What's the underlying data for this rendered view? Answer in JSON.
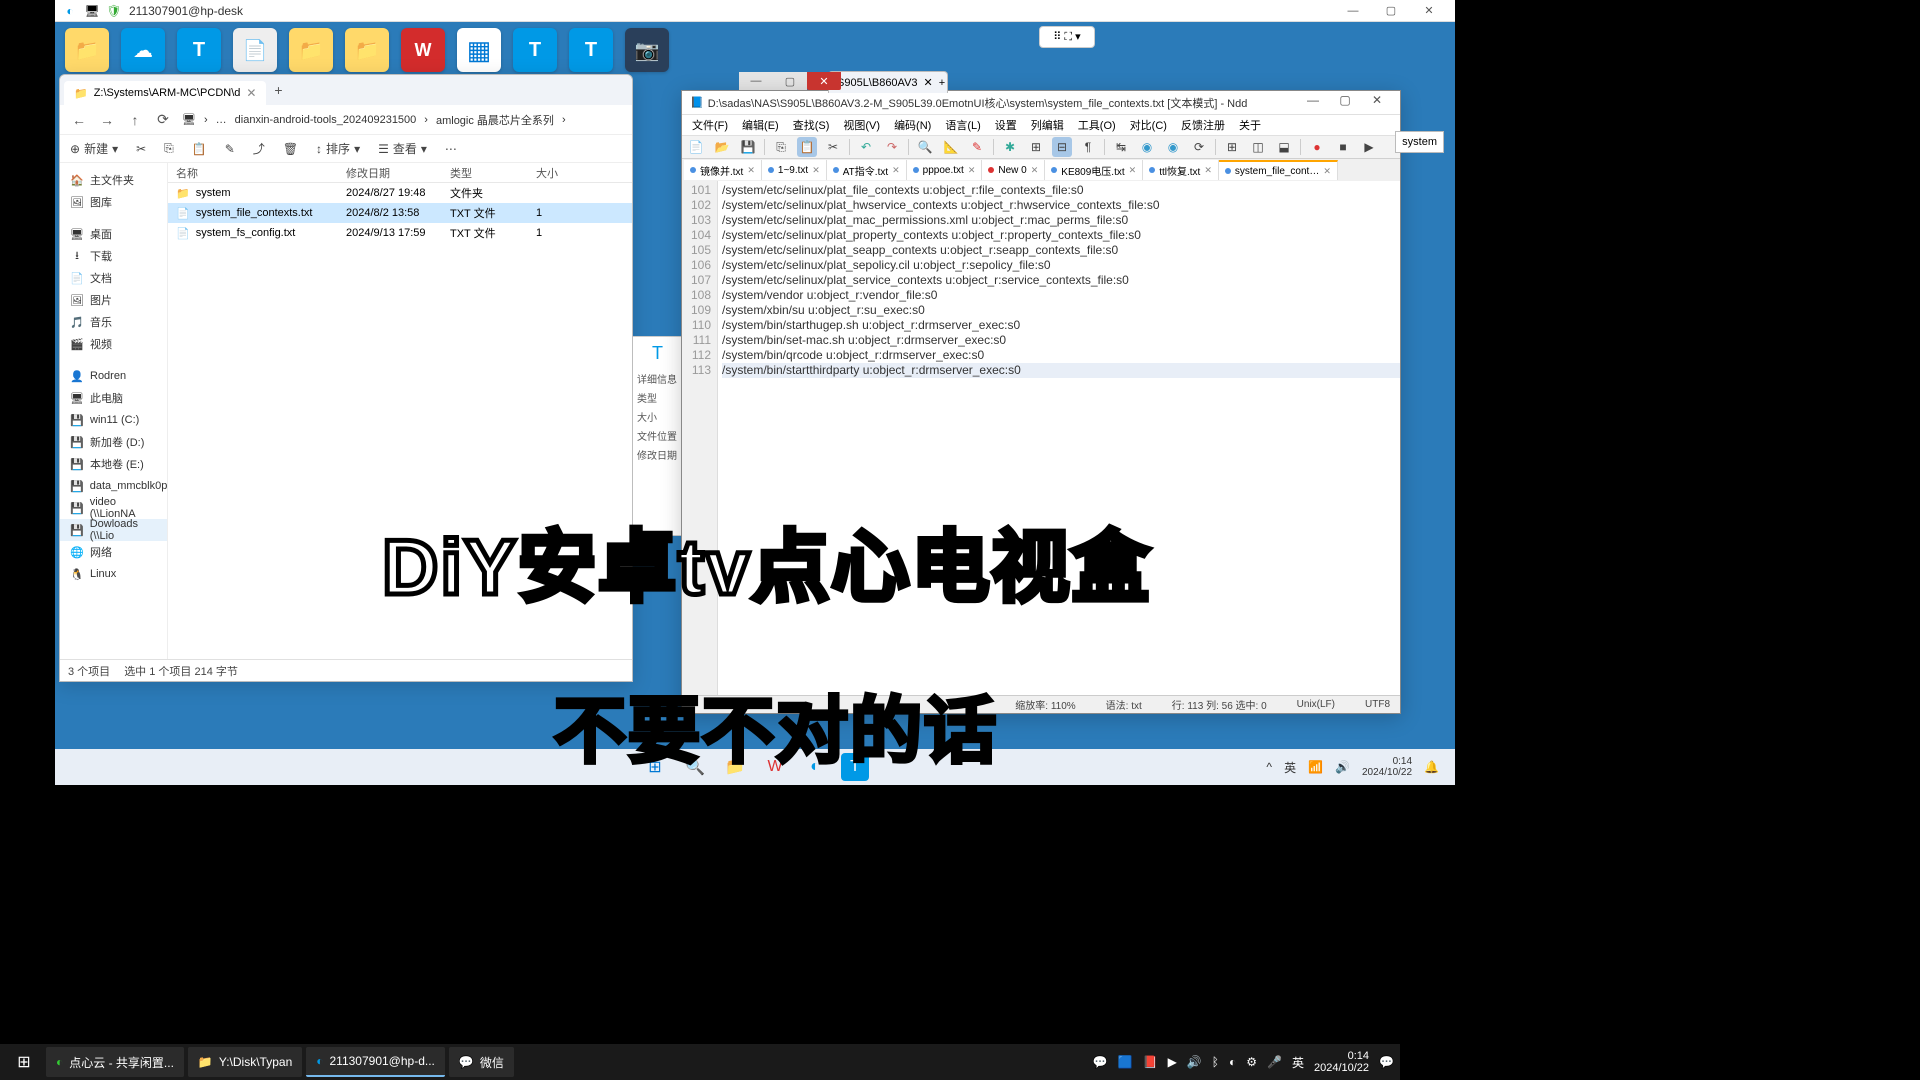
{
  "remote": {
    "title": "211307901@hp-desk"
  },
  "pill": "⠿ ⛶ ▾",
  "explorer": {
    "tab": "Z:\\Systems\\ARM-MC\\PCDN\\d",
    "bc1": "dianxin-android-tools_202409231500",
    "bc2": "amlogic 晶晨芯片全系列",
    "new": "新建",
    "sort": "排序",
    "view": "查看",
    "hdr": {
      "name": "名称",
      "date": "修改日期",
      "type": "类型",
      "size": "大小"
    },
    "files": [
      {
        "name": "system",
        "date": "2024/8/27 19:48",
        "type": "文件夹",
        "size": ""
      },
      {
        "name": "system_file_contexts.txt",
        "date": "2024/8/2 13:58",
        "type": "TXT 文件",
        "size": "1"
      },
      {
        "name": "system_fs_config.txt",
        "date": "2024/9/13 17:59",
        "type": "TXT 文件",
        "size": "1"
      }
    ],
    "side": {
      "home": "主文件夹",
      "gallery": "图库",
      "desktop": "桌面",
      "downloads": "下载",
      "documents": "文档",
      "pictures": "图片",
      "music": "音乐",
      "videos": "视频",
      "rodren": "Rodren",
      "pc": "此电脑",
      "drives": [
        "win11 (C:)",
        "新加卷 (D:)",
        "本地卷 (E:)",
        "data_mmcblk0p",
        "video (\\\\LionNA",
        "Dowloads (\\\\Lio"
      ],
      "network": "网络",
      "linux": "Linux"
    },
    "status": {
      "items": "3 个项目",
      "sel": "选中 1 个项目  214 字节"
    }
  },
  "bcard": {
    "title": "详细信息",
    "rows": [
      "类型",
      "大小",
      "文件位置",
      "修改日期"
    ]
  },
  "editor": {
    "extra_tab": "S905L\\B860AV3",
    "title": "D:\\sadas\\NAS\\S905L\\B860AV3.2-M_S905L39.0EmotnUI核心\\system\\system_file_contexts.txt [文本模式] - Ndd",
    "side": "system",
    "menu": [
      "文件(F)",
      "编辑(E)",
      "查找(S)",
      "视图(V)",
      "编码(N)",
      "语言(L)",
      "设置",
      "列编辑",
      "工具(O)",
      "对比(C)",
      "反馈注册",
      "关于"
    ],
    "tabs": [
      "镜像并.txt",
      "1~9.txt",
      "AT指令.txt",
      "pppoe.txt",
      "New 0",
      "KE809电压.txt",
      "ttl恢复.txt",
      "system_file_cont…"
    ],
    "lines": [
      {
        "n": 101,
        "t": "/system/etc/selinux/plat_file_contexts u:object_r:file_contexts_file:s0"
      },
      {
        "n": 102,
        "t": "/system/etc/selinux/plat_hwservice_contexts u:object_r:hwservice_contexts_file:s0"
      },
      {
        "n": 103,
        "t": "/system/etc/selinux/plat_mac_permissions.xml u:object_r:mac_perms_file:s0"
      },
      {
        "n": 104,
        "t": "/system/etc/selinux/plat_property_contexts u:object_r:property_contexts_file:s0"
      },
      {
        "n": 105,
        "t": "/system/etc/selinux/plat_seapp_contexts u:object_r:seapp_contexts_file:s0"
      },
      {
        "n": 106,
        "t": "/system/etc/selinux/plat_sepolicy.cil u:object_r:sepolicy_file:s0"
      },
      {
        "n": 107,
        "t": "/system/etc/selinux/plat_service_contexts u:object_r:service_contexts_file:s0"
      },
      {
        "n": 108,
        "t": "/system/vendor u:object_r:vendor_file:s0"
      },
      {
        "n": 109,
        "t": "/system/xbin/su u:object_r:su_exec:s0"
      },
      {
        "n": 110,
        "t": "/system/bin/starthugep.sh u:object_r:drmserver_exec:s0"
      },
      {
        "n": 111,
        "t": "/system/bin/set-mac.sh u:object_r:drmserver_exec:s0"
      },
      {
        "n": 112,
        "t": "/system/bin/qrcode u:object_r:drmserver_exec:s0"
      },
      {
        "n": 113,
        "t": "/system/bin/startthirdparty u:object_r:drmserver_exec:s0"
      }
    ],
    "status": {
      "zoom": "缩放率: 110%",
      "lang": "语法: txt",
      "pos": "行: 113 列: 56 选中: 0",
      "eol": "Unix(LF)",
      "enc": "UTF8"
    }
  },
  "overlay1": "DiY安卓tv点心电视盒",
  "overlay2": "不要不对的话",
  "inner_tb": {
    "time": "0:14",
    "date": "2024/10/22"
  },
  "host_tb": {
    "apps": [
      "点心云 - 共享闲置...",
      "Y:\\Disk\\Typan",
      "211307901@hp-d...",
      "微信"
    ],
    "time": "0:14",
    "date": "2024/10/22",
    "ime": "英"
  }
}
